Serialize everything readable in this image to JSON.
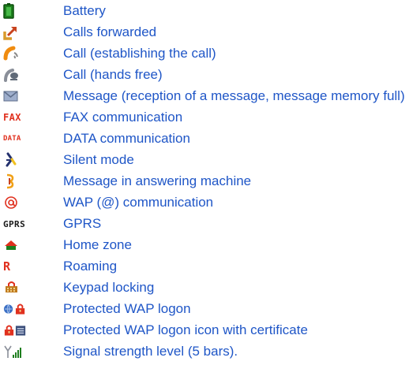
{
  "label_color": "#1f56c7",
  "rows": [
    {
      "icon": "battery-icon",
      "label": "Battery"
    },
    {
      "icon": "calls-forwarded-icon",
      "label": "Calls forwarded"
    },
    {
      "icon": "call-establishing-icon",
      "label": "Call (establishing the call)"
    },
    {
      "icon": "call-hands-free-icon",
      "label": "Call (hands free)"
    },
    {
      "icon": "message-envelope-icon",
      "label": "Message (reception of a message, message memory full)"
    },
    {
      "icon": "fax-icon",
      "label": "FAX communication",
      "icon_text": "FAX"
    },
    {
      "icon": "data-icon",
      "label": "DATA communication",
      "icon_text": "DATA"
    },
    {
      "icon": "silent-mode-icon",
      "label": "Silent mode"
    },
    {
      "icon": "answering-machine-icon",
      "label": "Message in answering machine"
    },
    {
      "icon": "wap-at-icon",
      "label": "WAP (@) communication"
    },
    {
      "icon": "gprs-icon",
      "label": "GPRS",
      "icon_text": "GPRS"
    },
    {
      "icon": "home-zone-icon",
      "label": "Home zone"
    },
    {
      "icon": "roaming-icon",
      "label": "Roaming",
      "icon_text": "R"
    },
    {
      "icon": "keypad-lock-icon",
      "label": "Keypad locking"
    },
    {
      "icon": "protected-wap-logon-icon",
      "label": "Protected WAP logon"
    },
    {
      "icon": "protected-wap-certificate-icon",
      "label": "Protected WAP logon icon with certificate"
    },
    {
      "icon": "signal-strength-icon",
      "label": "Signal strength level (5 bars)."
    }
  ]
}
